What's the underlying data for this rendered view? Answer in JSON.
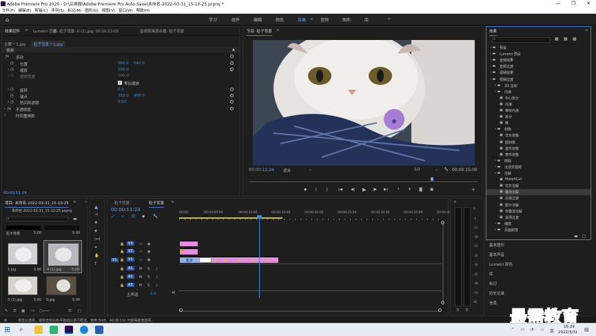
{
  "window": {
    "title": "Adobe Premiere Pro 2020 - D:\\兰周做\\Adobe Premiere Pro Auto-Save\\未命名-2022-03-31_15-10-25.prproj *",
    "controls": [
      "—",
      "❐",
      "✕"
    ]
  },
  "menu": [
    "文件(F)",
    "编辑(E)",
    "剪辑(C)",
    "序列(S)",
    "标记(M)",
    "图形(G)",
    "视图(V)",
    "窗口(W)",
    "帮助(H)"
  ],
  "workspaces": [
    {
      "label": "学习"
    },
    {
      "label": "组件"
    },
    {
      "label": "编辑"
    },
    {
      "label": "颜色"
    },
    {
      "label": "效果"
    },
    {
      "label": "音频"
    },
    {
      "label": "图形"
    },
    {
      "label": "库"
    }
  ],
  "workspaces_more": "»",
  "effect_controls": {
    "tabs": [
      "效果控件",
      "Lumetri 范围",
      "源: 粒子背景: 6 (1).jpg: 00:00:13:00",
      "音频剪辑混合器: 粒子背景"
    ],
    "master": "主要 * 1.jpg",
    "clip": "粒子背景 * 1.jpg",
    "section_video": "视频",
    "motion": "运动",
    "props": [
      {
        "name": "位置",
        "v1": "960.0",
        "v2": "540.0"
      },
      {
        "name": "缩放",
        "v1": "100.0",
        "v2": ""
      },
      {
        "name": "缩放宽度",
        "v1": "100.0",
        "v2": ""
      },
      {
        "name": "旋转",
        "v1": "0.0",
        "v2": ""
      },
      {
        "name": "锚点",
        "v1": "352.0",
        "v2": "409.0"
      },
      {
        "name": "防闪烁滤镜",
        "v1": "0.00",
        "v2": ""
      }
    ],
    "uniform_scale": "等比缩放",
    "opacity": "不透明度",
    "time_remap": "时间重映射",
    "timecode": "00:00:11:24"
  },
  "program": {
    "title": "节目: 粒子背景",
    "timecode": "00:00:11:24",
    "fit": "适合",
    "quality": "1/2",
    "duration": "00:00:15:00"
  },
  "project": {
    "title": "项目: 未命名-2022-03-31_15-10-25",
    "subtitle": "未命名-2022-03-31_15-10-25.prproj",
    "items": [
      {
        "name": "粒子背景",
        "dur": "5:00"
      },
      {
        "name": "1.jpg",
        "dur": "5:00"
      },
      {
        "name": "4 (1).jpg",
        "dur": "5:00"
      },
      {
        "name": "3 (1).jpg",
        "dur": "5:00"
      },
      {
        "name": "5.jpg",
        "dur": "5:00"
      }
    ]
  },
  "timeline": {
    "tabs": [
      "粒子背景",
      "粒子背景"
    ],
    "timecode": "00:00:11:24",
    "ruler": [
      "00:00",
      "00:00:05:00",
      "00:00:10:00",
      "00:00:15:00",
      "00:00:20:00",
      "00:00:25:00",
      "00:00:30:00",
      "00:00:35:00",
      "00:00:40:00"
    ],
    "tracks": [
      "V3",
      "V2",
      "V1",
      "A1",
      "A2",
      "A3"
    ],
    "master": "主声道",
    "master_val": "0.0",
    "clip_label": "粒子",
    "v1_src": "V1"
  },
  "effects": {
    "title": "效果",
    "tree": [
      {
        "label": "预设",
        "lvl": 0
      },
      {
        "label": "Lumetri 预设",
        "lvl": 0
      },
      {
        "label": "音频效果",
        "lvl": 0
      },
      {
        "label": "音频过渡",
        "lvl": 0
      },
      {
        "label": "视频效果",
        "lvl": 0
      },
      {
        "label": "视频过渡",
        "lvl": 0
      },
      {
        "label": "3D 运动",
        "lvl": 1
      },
      {
        "label": "内滑",
        "lvl": 1
      },
      {
        "label": "中心拆分",
        "lvl": 2
      },
      {
        "label": "内滑",
        "lvl": 2
      },
      {
        "label": "带状内滑",
        "lvl": 2
      },
      {
        "label": "拆分",
        "lvl": 2
      },
      {
        "label": "推",
        "lvl": 2
      },
      {
        "label": "划像",
        "lvl": 1
      },
      {
        "label": "交叉划像",
        "lvl": 2
      },
      {
        "label": "圆划像",
        "lvl": 2
      },
      {
        "label": "盒形划像",
        "lvl": 2
      },
      {
        "label": "菱形划像",
        "lvl": 2
      },
      {
        "label": "擦除",
        "lvl": 1
      },
      {
        "label": "沉浸式视频",
        "lvl": 1
      },
      {
        "label": "溶解",
        "lvl": 1
      },
      {
        "label": "MorphCut",
        "lvl": 2
      },
      {
        "label": "交叉溶解",
        "lvl": 2
      },
      {
        "label": "叠加溶解",
        "lvl": 2
      },
      {
        "label": "白场过渡",
        "lvl": 2
      },
      {
        "label": "胶片溶解",
        "lvl": 2
      },
      {
        "label": "非叠加溶解",
        "lvl": 2
      },
      {
        "label": "黑场过渡",
        "lvl": 2
      },
      {
        "label": "缩放",
        "lvl": 1
      },
      {
        "label": "页面剥落",
        "lvl": 1
      }
    ],
    "selected": "叠加溶解"
  },
  "side_panels": [
    "基本图形",
    "基本声音",
    "Lumetri 颜色",
    "库",
    "标记",
    "历史记录",
    "信息"
  ],
  "meter_labels": [
    "0",
    "-6",
    "-12",
    "-18",
    "-24",
    "-30",
    "-36",
    "-42",
    "-48",
    "-54",
    "dB"
  ],
  "meter_foot": [
    "S",
    "S"
  ],
  "status": "单击以选择，或单击空白处并拖动以进行框选。使用 Shift、Alt 和 Ctrl 可获得其他选项。",
  "watermark": "最需教育",
  "clock": {
    "time": "15:29",
    "date": "2022/3/31"
  },
  "tray_lang": "英"
}
